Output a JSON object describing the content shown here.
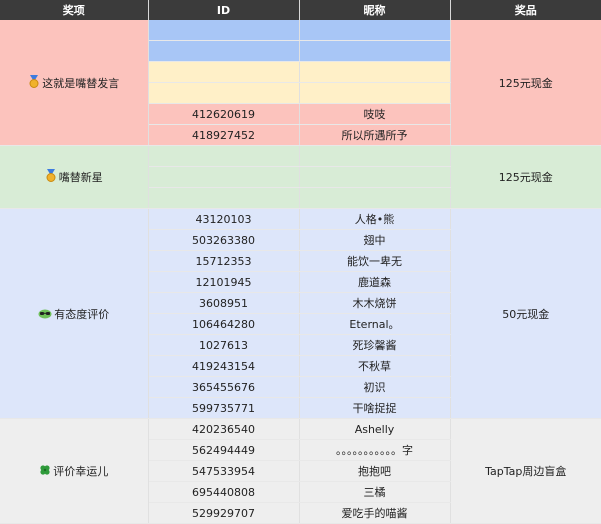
{
  "header": {
    "award": "奖项",
    "id": "ID",
    "nickname": "昵称",
    "prize": "奖品"
  },
  "groups": {
    "g1": {
      "award": "这就是嘴替发言",
      "icon": "medal-icon",
      "prize": "125元现金",
      "rows": [
        {
          "id": "412620619",
          "nickname": "吱吱"
        },
        {
          "id": "418927452",
          "nickname": "所以所遇所予"
        }
      ]
    },
    "g2": {
      "award": "嘴替新星",
      "icon": "medal-icon",
      "prize": "125元现金"
    },
    "g3": {
      "award": "有态度评价",
      "icon": "sunglasses-icon",
      "prize": "50元现金",
      "rows": [
        {
          "id": "43120103",
          "nickname": "人格•熊"
        },
        {
          "id": "503263380",
          "nickname": "翅中"
        },
        {
          "id": "15712353",
          "nickname": "能饮一卑无"
        },
        {
          "id": "12101945",
          "nickname": "鹿道森"
        },
        {
          "id": "3608951",
          "nickname": "木木烧饼"
        },
        {
          "id": "106464280",
          "nickname": "Eternal。"
        },
        {
          "id": "1027613",
          "nickname": "死珍馨酱"
        },
        {
          "id": "419243154",
          "nickname": "不秋草"
        },
        {
          "id": "365455676",
          "nickname": "初识"
        },
        {
          "id": "599735771",
          "nickname": "干啥捉捉"
        }
      ]
    },
    "g4": {
      "award": "评价幸运儿",
      "icon": "clover-icon",
      "prize": "TapTap周边盲盒",
      "rows": [
        {
          "id": "420236540",
          "nickname": "Ashelly"
        },
        {
          "id": "562494449",
          "nickname": "。。。。。。。。。。。字"
        },
        {
          "id": "547533954",
          "nickname": "抱抱吧"
        },
        {
          "id": "695440808",
          "nickname": "三橘"
        },
        {
          "id": "529929707",
          "nickname": "爱吃手的喵酱"
        }
      ]
    }
  },
  "colors": {
    "header": "#3b3b3b",
    "g1": "#fcc3bd",
    "g1_blue": "#a8c6f6",
    "g1_yellow": "#fff0c8",
    "g2": "#d8ecd6",
    "g3": "#dde6fa",
    "g4": "#eeeeee"
  }
}
